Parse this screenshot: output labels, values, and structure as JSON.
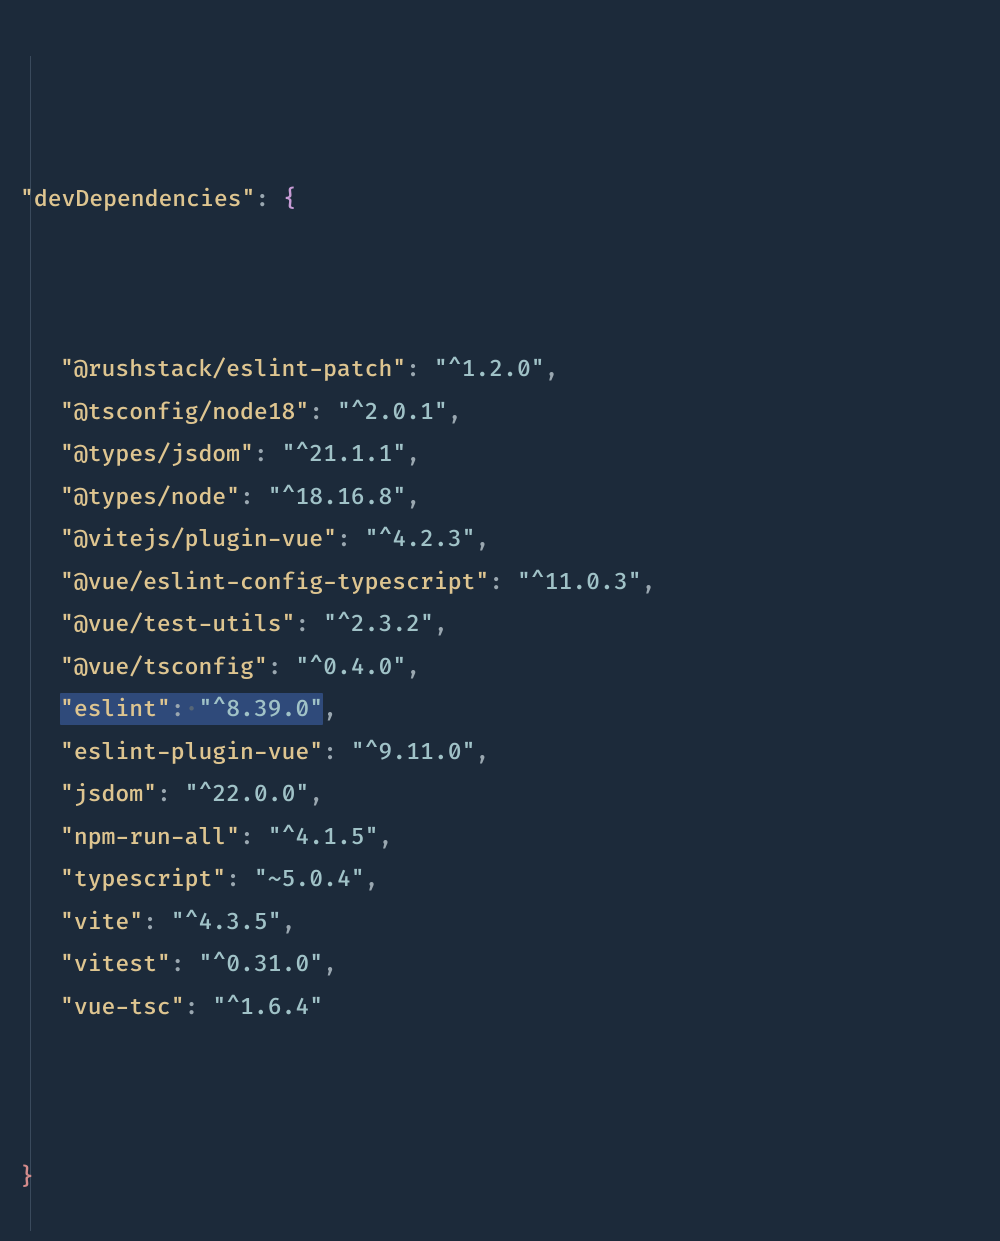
{
  "section_key": "\"devDependencies\"",
  "deps": [
    {
      "name": "\"@rushstack/eslint-patch\"",
      "version": "\"^1.2.0\""
    },
    {
      "name": "\"@tsconfig/node18\"",
      "version": "\"^2.0.1\""
    },
    {
      "name": "\"@types/jsdom\"",
      "version": "\"^21.1.1\""
    },
    {
      "name": "\"@types/node\"",
      "version": "\"^18.16.8\""
    },
    {
      "name": "\"@vitejs/plugin-vue\"",
      "version": "\"^4.2.3\""
    },
    {
      "name": "\"@vue/eslint-config-typescript\"",
      "version": "\"^11.0.3\""
    },
    {
      "name": "\"@vue/test-utils\"",
      "version": "\"^2.3.2\""
    },
    {
      "name": "\"@vue/tsconfig\"",
      "version": "\"^0.4.0\""
    },
    {
      "name": "\"eslint\"",
      "version": "\"^8.39.0\"",
      "selected": true
    },
    {
      "name": "\"eslint-plugin-vue\"",
      "version": "\"^9.11.0\""
    },
    {
      "name": "\"jsdom\"",
      "version": "\"^22.0.0\""
    },
    {
      "name": "\"npm-run-all\"",
      "version": "\"^4.1.5\""
    },
    {
      "name": "\"typescript\"",
      "version": "\"~5.0.4\""
    },
    {
      "name": "\"vite\"",
      "version": "\"^4.3.5\""
    },
    {
      "name": "\"vitest\"",
      "version": "\"^0.31.0\""
    },
    {
      "name": "\"vue-tsc\"",
      "version": "\"^1.6.4\""
    }
  ],
  "tokens": {
    "colon": ":",
    "space": " ",
    "comma": ",",
    "open_brace": "{",
    "close_brace": "}",
    "whitespace_dot": "·"
  }
}
